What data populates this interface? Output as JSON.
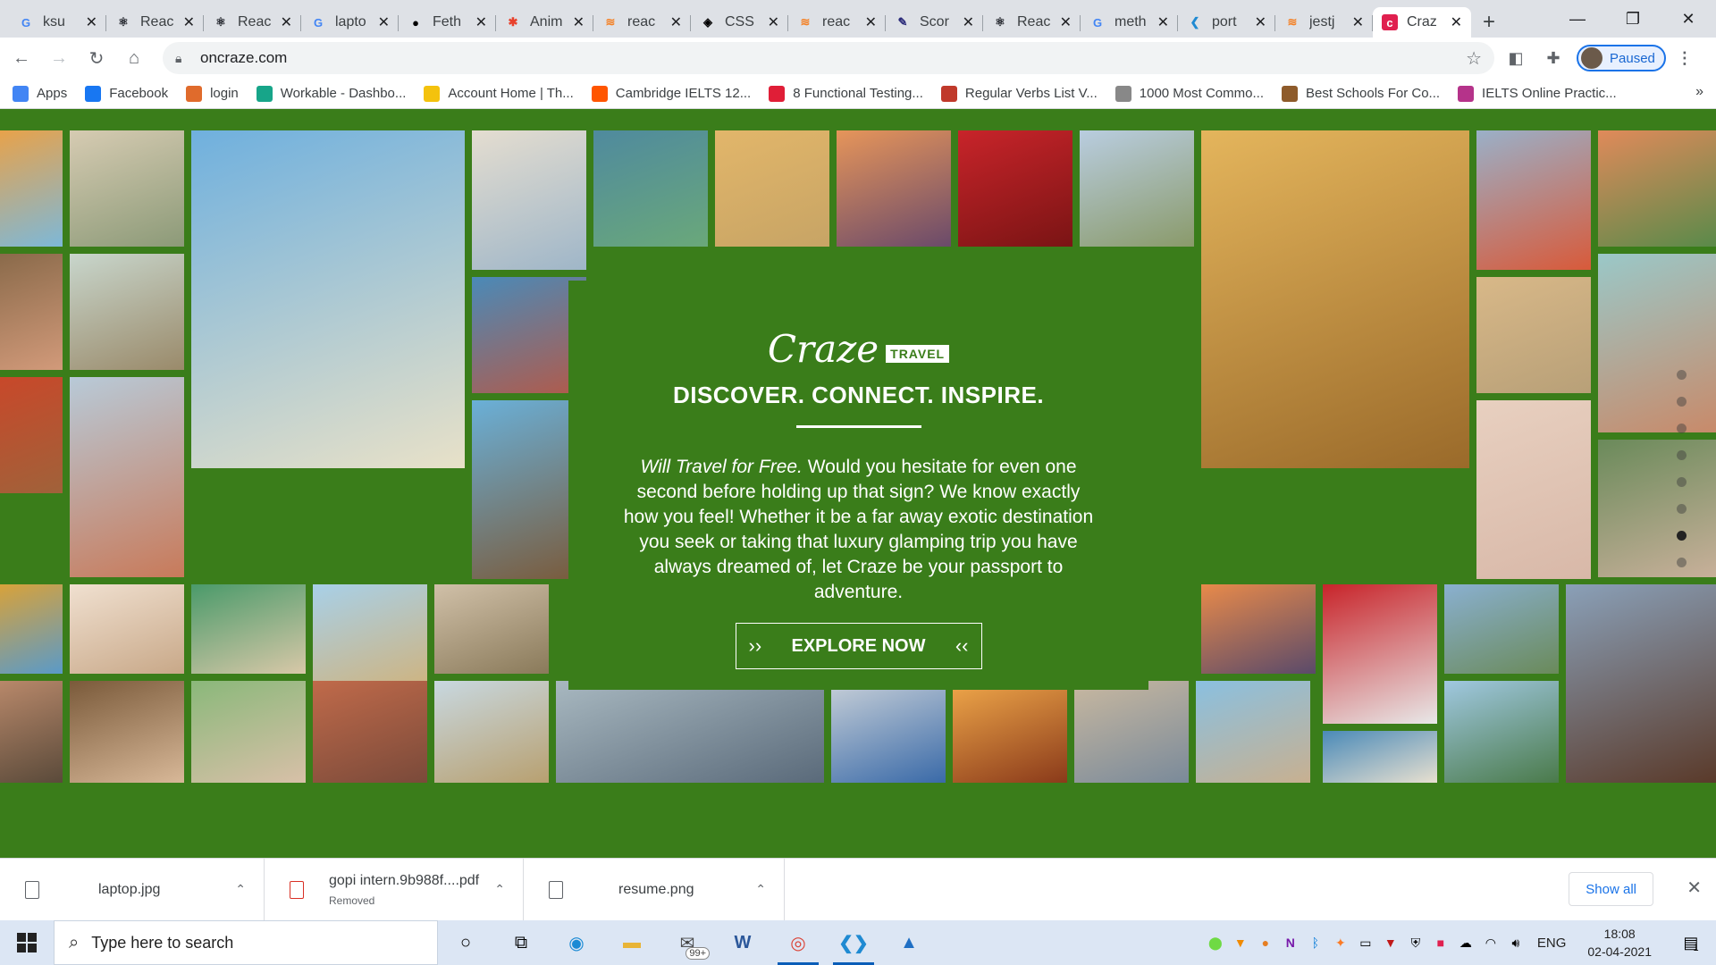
{
  "browser": {
    "tabs": [
      {
        "title": "ksu",
        "icon": "google-icon",
        "color": "#4285f4",
        "glyph": "G"
      },
      {
        "title": "Reac",
        "icon": "react-icon",
        "color": "#20232a",
        "glyph": "⚛"
      },
      {
        "title": "Reac",
        "icon": "react-icon",
        "color": "#20232a",
        "glyph": "⚛"
      },
      {
        "title": "lapto",
        "icon": "google-icon",
        "color": "#4285f4",
        "glyph": "G"
      },
      {
        "title": "Feth",
        "icon": "bag-icon",
        "color": "#000000",
        "glyph": "●"
      },
      {
        "title": "Anim",
        "icon": "asterisk-icon",
        "color": "#e8412c",
        "glyph": "✱"
      },
      {
        "title": "reac",
        "icon": "stack-icon",
        "color": "#f48024",
        "glyph": "≋"
      },
      {
        "title": "CSS",
        "icon": "codepen-icon",
        "color": "#000000",
        "glyph": "◈"
      },
      {
        "title": "reac",
        "icon": "stack-icon",
        "color": "#f48024",
        "glyph": "≋"
      },
      {
        "title": "Scor",
        "icon": "feather-icon",
        "color": "#2b2b7a",
        "glyph": "✎"
      },
      {
        "title": "Reac",
        "icon": "react-icon",
        "color": "#20232a",
        "glyph": "⚛"
      },
      {
        "title": "meth",
        "icon": "google-icon",
        "color": "#4285f4",
        "glyph": "G"
      },
      {
        "title": "port",
        "icon": "vscode-icon",
        "color": "#1f8ad2",
        "glyph": "❮"
      },
      {
        "title": "jestj",
        "icon": "stack-icon",
        "color": "#f48024",
        "glyph": "≋"
      },
      {
        "title": "Craz",
        "icon": "craze-icon",
        "color": "#e0204f",
        "glyph": "c",
        "active": true
      }
    ],
    "new_tab": "+",
    "window_controls": {
      "minimize": "—",
      "restore": "❐",
      "close": "✕"
    },
    "url": "oncraze.com",
    "profile_label": "Paused",
    "bookmarks": [
      {
        "label": "Apps",
        "icon": "apps-grid-icon",
        "color": "#4285f4"
      },
      {
        "label": "Facebook",
        "icon": "facebook-icon",
        "color": "#1877f2"
      },
      {
        "label": "login",
        "icon": "login-icon",
        "color": "#e06b2c"
      },
      {
        "label": "Workable - Dashbo...",
        "icon": "workable-icon",
        "color": "#17a589"
      },
      {
        "label": "Account Home | Th...",
        "icon": "account-icon",
        "color": "#f4c20d"
      },
      {
        "label": "Cambridge IELTS 12...",
        "icon": "soundcloud-icon",
        "color": "#ff5500"
      },
      {
        "label": "8 Functional Testing...",
        "icon": "testing-icon",
        "color": "#e01e37"
      },
      {
        "label": "Regular Verbs List V...",
        "icon": "verbs-icon",
        "color": "#c0392b"
      },
      {
        "label": "1000 Most Commo...",
        "icon": "dash-icon",
        "color": "#888888"
      },
      {
        "label": "Best Schools For Co...",
        "icon": "school-icon",
        "color": "#8e5b2b"
      },
      {
        "label": "IELTS Online Practic...",
        "icon": "ielts-icon",
        "color": "#b5338a"
      }
    ]
  },
  "hero": {
    "brand": "Craze",
    "brand_badge": "TRAVEL",
    "tagline": "DISCOVER. CONNECT. INSPIRE.",
    "lead_italic": "Will Travel for Free.",
    "description": " Would you hesitate for even one second before holding up that sign? We know exactly how you feel! Whether it be a far away exotic destination you seek or taking that luxury glamping trip you have always dreamed of, let Craze be your passport to adventure.",
    "cta_label": "EXPLORE NOW",
    "carousel_dots": 8,
    "carousel_active_index": 6,
    "brand_color": "#3a7d1a"
  },
  "downloads": {
    "items": [
      {
        "name": "laptop.jpg",
        "status": ""
      },
      {
        "name": "gopi intern.9b988f....pdf",
        "status": "Removed"
      },
      {
        "name": "resume.png",
        "status": ""
      }
    ],
    "show_all": "Show all"
  },
  "taskbar": {
    "search_placeholder": "Type here to search",
    "mail_badge": "99+",
    "language": "ENG",
    "time": "18:08",
    "date": "02-04-2021",
    "notifications": "1"
  }
}
